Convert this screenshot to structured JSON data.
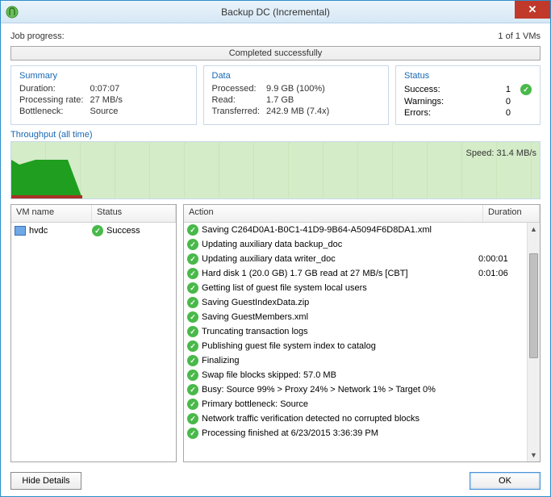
{
  "window": {
    "title": "Backup DC (Incremental)"
  },
  "progress": {
    "label": "Job progress:",
    "right": "1 of 1 VMs",
    "bar_text": "Completed successfully"
  },
  "summary": {
    "title": "Summary",
    "duration_label": "Duration:",
    "duration": "0:07:07",
    "rate_label": "Processing rate:",
    "rate": "27 MB/s",
    "bottleneck_label": "Bottleneck:",
    "bottleneck": "Source"
  },
  "data_panel": {
    "title": "Data",
    "processed_label": "Processed:",
    "processed": "9.9 GB (100%)",
    "read_label": "Read:",
    "read": "1.7 GB",
    "transferred_label": "Transferred:",
    "transferred": "242.9 MB (7.4x)"
  },
  "status_panel": {
    "title": "Status",
    "success_label": "Success:",
    "success": "1",
    "warnings_label": "Warnings:",
    "warnings": "0",
    "errors_label": "Errors:",
    "errors": "0"
  },
  "throughput": {
    "title": "Throughput (all time)",
    "speed": "Speed: 31.4 MB/s"
  },
  "vm_list": {
    "col_vm": "VM name",
    "col_status": "Status",
    "rows": [
      {
        "name": "hvdc",
        "status": "Success"
      }
    ]
  },
  "action_list": {
    "col_action": "Action",
    "col_duration": "Duration",
    "rows": [
      {
        "text": "Saving C264D0A1-B0C1-41D9-9B64-A5094F6D8DA1.xml",
        "duration": ""
      },
      {
        "text": "Updating auxiliary data backup_doc",
        "duration": ""
      },
      {
        "text": "Updating auxiliary data writer_doc",
        "duration": "0:00:01"
      },
      {
        "text": "Hard disk 1 (20.0 GB) 1.7 GB read at 27 MB/s [CBT]",
        "duration": "0:01:06"
      },
      {
        "text": "Getting list of guest file system local users",
        "duration": ""
      },
      {
        "text": "Saving GuestIndexData.zip",
        "duration": ""
      },
      {
        "text": "Saving GuestMembers.xml",
        "duration": ""
      },
      {
        "text": "Truncating transaction logs",
        "duration": ""
      },
      {
        "text": "Publishing guest file system index to catalog",
        "duration": ""
      },
      {
        "text": "Finalizing",
        "duration": ""
      },
      {
        "text": "Swap file blocks skipped: 57.0 MB",
        "duration": ""
      },
      {
        "text": "Busy: Source 99% > Proxy 24% > Network 1% > Target 0%",
        "duration": ""
      },
      {
        "text": "Primary bottleneck: Source",
        "duration": ""
      },
      {
        "text": "Network traffic verification detected no corrupted blocks",
        "duration": ""
      },
      {
        "text": "Processing finished at 6/23/2015 3:36:39 PM",
        "duration": ""
      }
    ]
  },
  "footer": {
    "hide": "Hide Details",
    "ok": "OK"
  },
  "chart_data": {
    "type": "area",
    "title": "Throughput (all time)",
    "ylabel": "MB/s",
    "speed_current": 31.4,
    "note": "solid green throughput bar occupies roughly first 13% of timeline at near-full height, then drops to zero; background shaded light green"
  }
}
